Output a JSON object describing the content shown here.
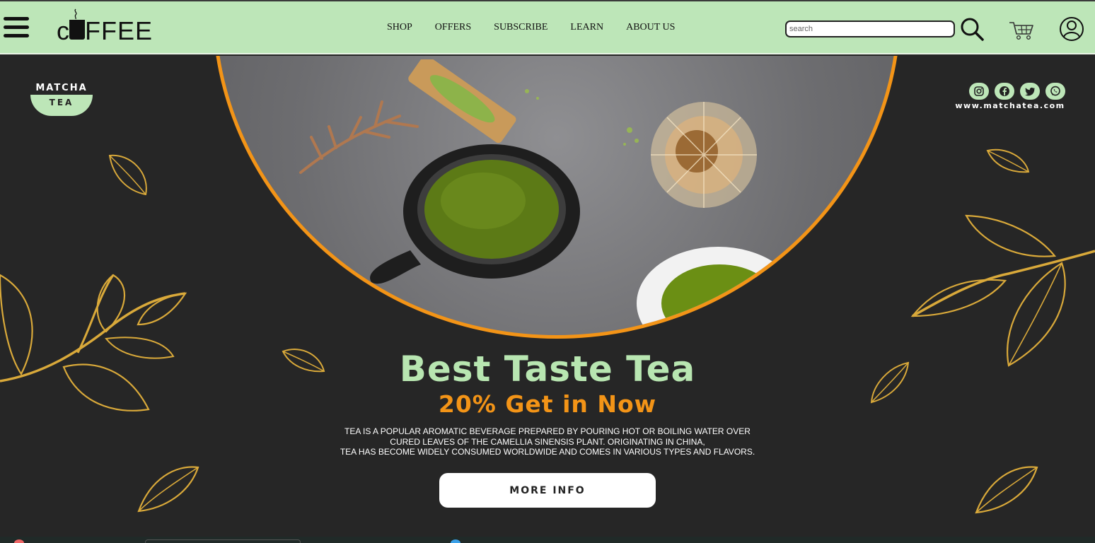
{
  "header": {
    "brand_text": "FFEE",
    "nav": [
      "SHOP",
      "OFFERS",
      "SUBSCRIBE",
      "LEARN",
      "ABOUT US"
    ],
    "search": {
      "placeholder": "search",
      "value": ""
    }
  },
  "hero": {
    "badge_top": "MATCHA",
    "badge_bottom": "TEA",
    "socials": [
      "instagram-icon",
      "facebook-icon",
      "twitter-icon",
      "whatsapp-icon"
    ],
    "site_url": "www.matchatea.com",
    "headline": "Best Taste Tea",
    "subhead": "20% Get in Now",
    "description": [
      "TEA IS A POPULAR AROMATIC BEVERAGE PREPARED BY POURING HOT OR BOILING WATER OVER",
      "CURED LEAVES OF THE CAMELLIA SINENSIS PLANT. ORIGINATING IN CHINA,",
      "TEA HAS BECOME WIDELY CONSUMED WORLDWIDE AND COMES IN VARIOUS TYPES AND FLAVORS."
    ],
    "button_label": "MORE INFO"
  },
  "colors": {
    "header_bg": "#bde6b8",
    "page_bg": "#262626",
    "accent_orange": "#f39417",
    "accent_green": "#b8e6b1",
    "gold": "#d9a93a"
  }
}
